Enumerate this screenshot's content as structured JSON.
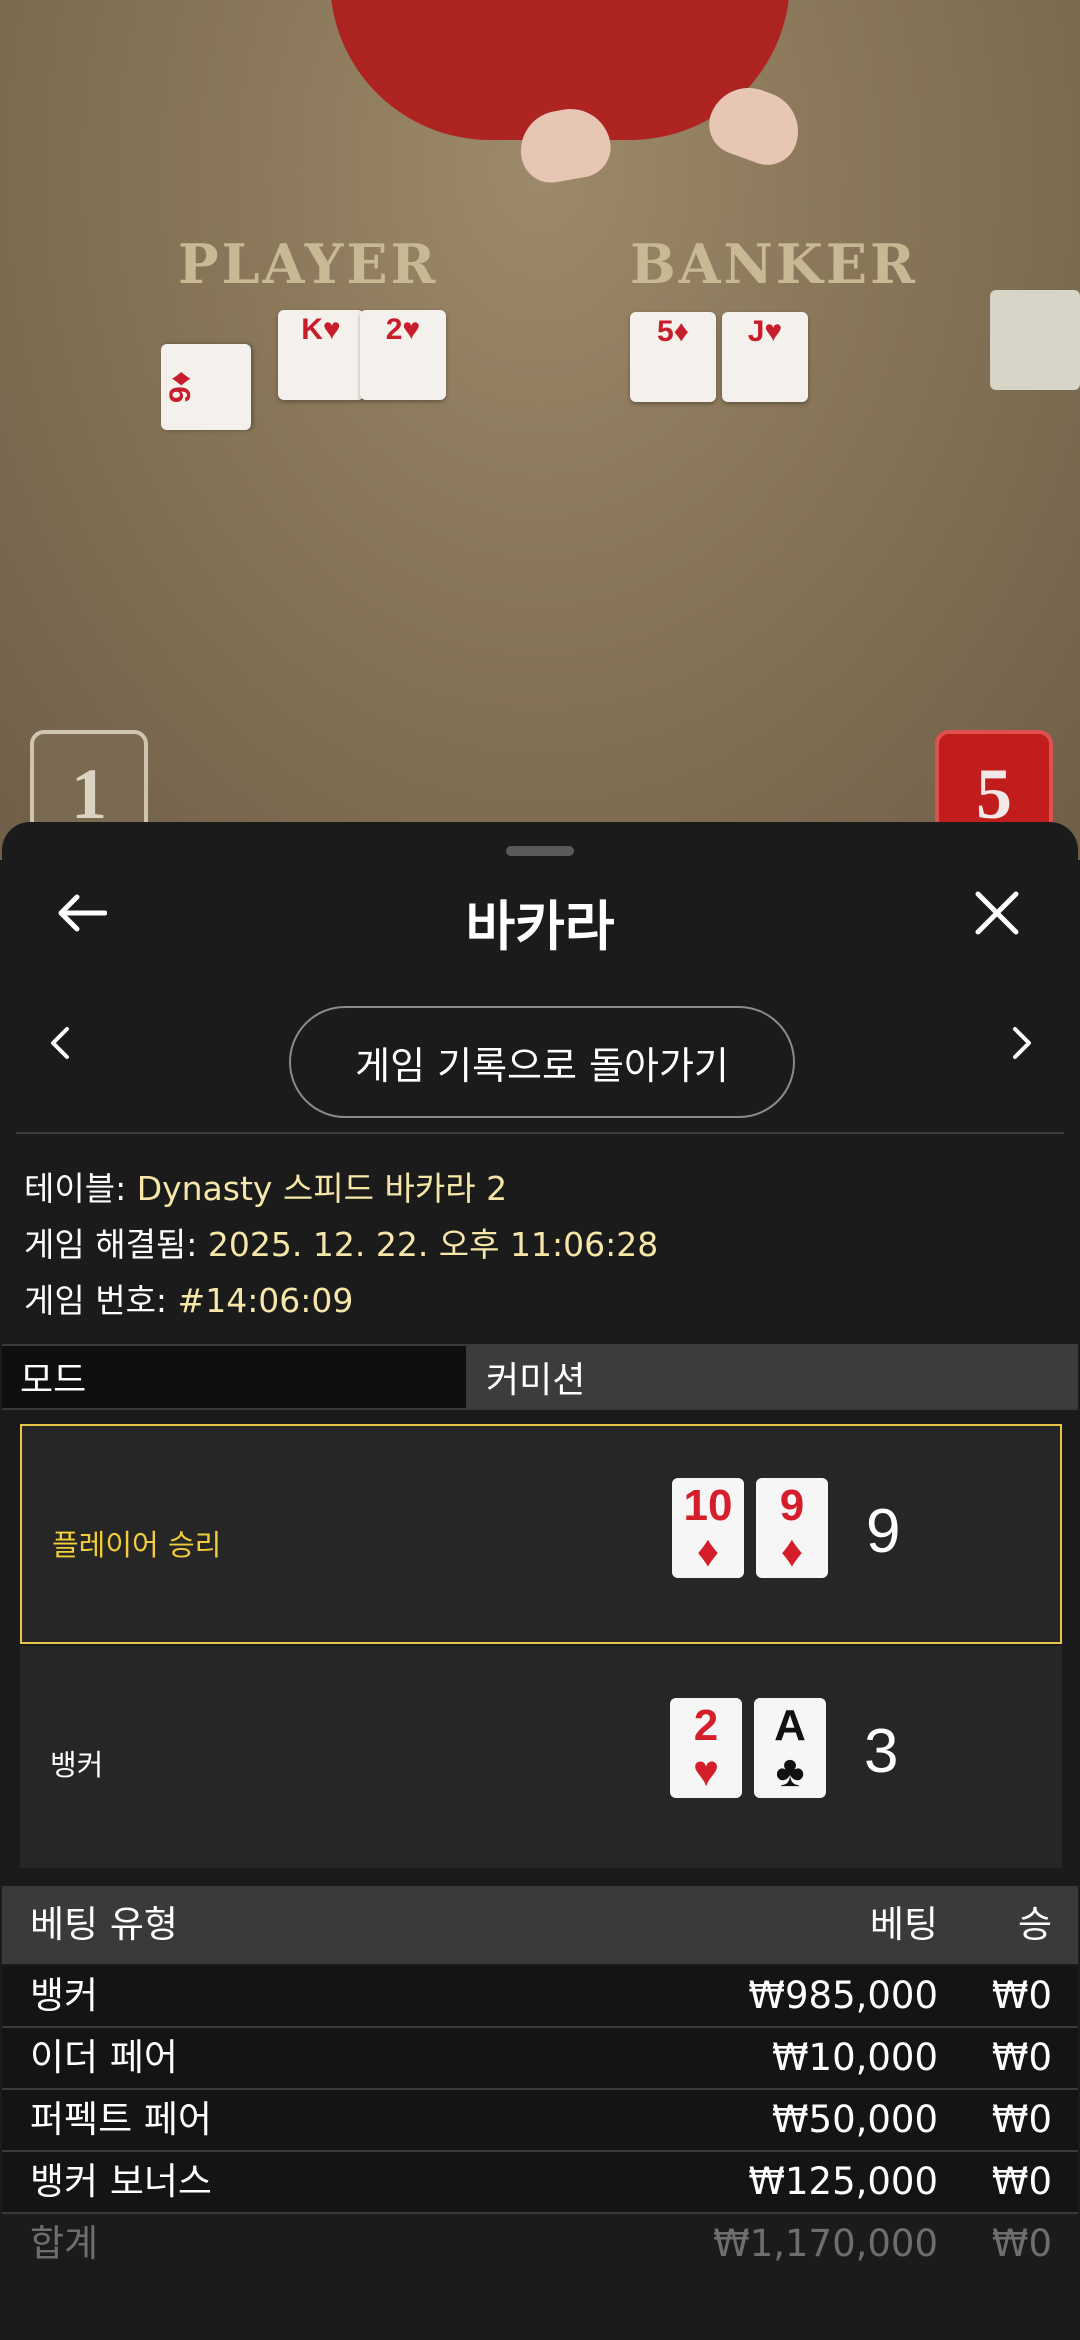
{
  "video": {
    "player_label": "PLAYER",
    "banker_label": "BANKER",
    "player_cards": [
      "9♦",
      "K♥",
      "2♥"
    ],
    "banker_cards": [
      "5♦",
      "J♥"
    ],
    "player_score": "1",
    "banker_score": "5"
  },
  "sheet": {
    "title": "바카라",
    "back_to_history": "게임 기록으로 돌아가기",
    "table": {
      "label": "테이블: ",
      "value": "Dynasty 스피드 바카라 2"
    },
    "resolved": {
      "label": "게임 해결됨: ",
      "value": "2025. 12. 22. 오후 11:06:28"
    },
    "game_no": {
      "label": "게임 번호: ",
      "value": "#14:06:09"
    },
    "tabs": {
      "mode": "모드",
      "commission": "커미션"
    },
    "hands": [
      {
        "label": "플레이어 승리",
        "cards": [
          {
            "rank": "10",
            "suit": "♦",
            "color": "red"
          },
          {
            "rank": "9",
            "suit": "♦",
            "color": "red"
          }
        ],
        "score": "9"
      },
      {
        "label": "뱅커",
        "cards": [
          {
            "rank": "2",
            "suit": "♥",
            "color": "red"
          },
          {
            "rank": "A",
            "suit": "♣",
            "color": "black"
          }
        ],
        "score": "3"
      }
    ],
    "bets": {
      "headers": {
        "type": "베팅 유형",
        "bet": "베팅",
        "win": "승"
      },
      "rows": [
        {
          "type": "뱅커",
          "bet": "₩985,000",
          "win": "₩0"
        },
        {
          "type": "이더 페어",
          "bet": "₩10,000",
          "win": "₩0"
        },
        {
          "type": "퍼펙트 페어",
          "bet": "₩50,000",
          "win": "₩0"
        },
        {
          "type": "뱅커 보너스",
          "bet": "₩125,000",
          "win": "₩0"
        }
      ],
      "total": {
        "type": "합계",
        "bet": "₩1,170,000",
        "win": "₩0"
      }
    }
  },
  "colors": {
    "accent": "#f2cd3b",
    "info_value": "#f6e7a8",
    "banker_red": "#c21d1d"
  }
}
